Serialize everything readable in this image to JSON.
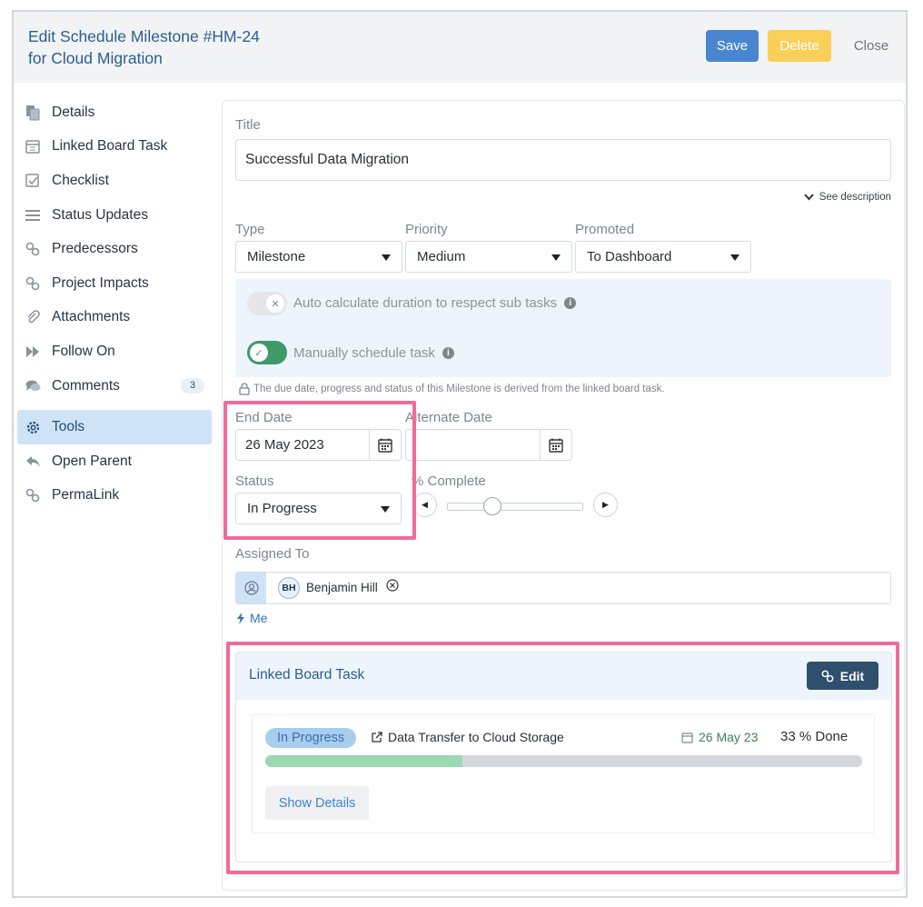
{
  "header": {
    "title_line1": "Edit Schedule Milestone #HM-24",
    "title_line2": "for Cloud Migration",
    "save_label": "Save",
    "delete_label": "Delete",
    "close_label": "Close"
  },
  "sidebar": {
    "items": [
      {
        "label": "Details",
        "icon": "documents-icon"
      },
      {
        "label": "Linked Board Task",
        "icon": "calendar-icon"
      },
      {
        "label": "Checklist",
        "icon": "checkbox-icon"
      },
      {
        "label": "Status Updates",
        "icon": "lines-icon"
      },
      {
        "label": "Predecessors",
        "icon": "link-icon"
      },
      {
        "label": "Project Impacts",
        "icon": "link-icon"
      },
      {
        "label": "Attachments",
        "icon": "paperclip-icon"
      },
      {
        "label": "Follow On",
        "icon": "fast-forward-icon"
      },
      {
        "label": "Comments",
        "icon": "comments-icon",
        "badge": "3"
      },
      {
        "label": "Tools",
        "icon": "gear-icon",
        "active": true
      },
      {
        "label": "Open Parent",
        "icon": "reply-icon"
      },
      {
        "label": "PermaLink",
        "icon": "link-icon"
      }
    ]
  },
  "form": {
    "title_label": "Title",
    "title_value": "Successful Data Migration",
    "see_description": "See description",
    "type_label": "Type",
    "type_value": "Milestone",
    "priority_label": "Priority",
    "priority_value": "Medium",
    "promoted_label": "Promoted",
    "promoted_value": "To Dashboard",
    "auto_calc_label": "Auto calculate duration to respect sub tasks",
    "auto_calc_on": false,
    "manual_schedule_label": "Manually schedule task",
    "manual_schedule_on": true,
    "lock_note": "The due date, progress and status of this Milestone is derived from the linked board task.",
    "end_date_label": "End Date",
    "end_date_value": "26 May 2023",
    "alternate_date_label": "Alternate Date",
    "alternate_date_value": "",
    "status_label": "Status",
    "status_value": "In Progress",
    "complete_label": "% Complete",
    "complete_fraction": 0.33,
    "assigned_label": "Assigned To",
    "assignee_initials": "BH",
    "assignee_name": "Benjamin Hill",
    "me_label": "Me"
  },
  "linked_task": {
    "header": "Linked Board Task",
    "edit_label": "Edit",
    "status_pill": "In Progress",
    "task_name": "Data Transfer to Cloud Storage",
    "due_date": "26 May 23",
    "done_text": "33 % Done",
    "progress_fraction": 0.33,
    "show_details_label": "Show Details"
  },
  "colors": {
    "accent": "#4a86d0",
    "highlight": "#f06b9a",
    "delete": "#f9cf59",
    "toggle_on": "#3f9a6a"
  }
}
